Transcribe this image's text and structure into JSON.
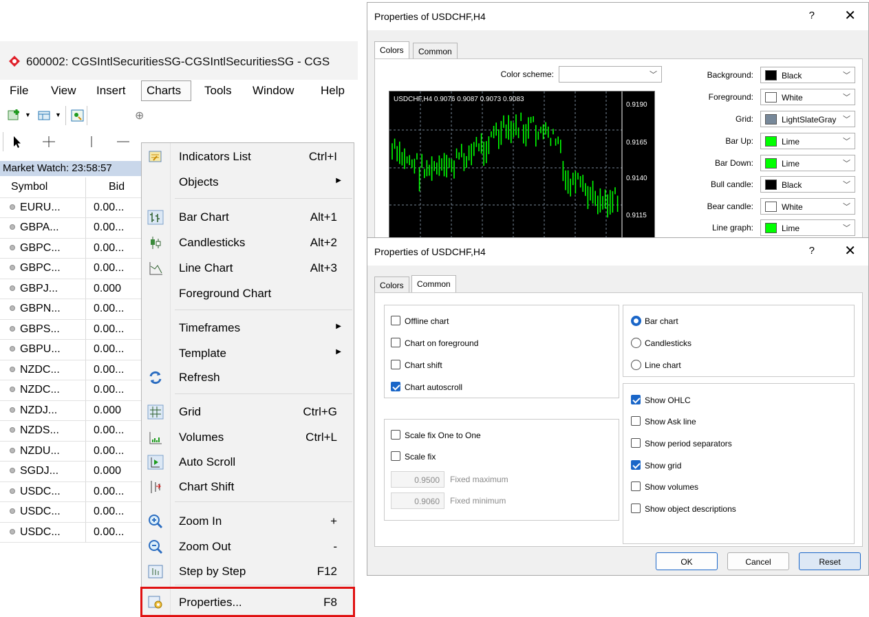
{
  "mt4": {
    "title": "600002: CGSIntlSecuritiesSG-CGSIntlSecuritiesSG - CGS",
    "menu": {
      "file": "File",
      "view": "View",
      "insert": "Insert",
      "charts": "Charts",
      "tools": "Tools",
      "window": "Window",
      "help": "Help"
    },
    "market_watch": {
      "header": "Market Watch: 23:58:57",
      "col_symbol": "Symbol",
      "col_bid": "Bid",
      "rows": [
        {
          "symbol": "EURU...",
          "bid": "0.00..."
        },
        {
          "symbol": "GBPA...",
          "bid": "0.00..."
        },
        {
          "symbol": "GBPC...",
          "bid": "0.00..."
        },
        {
          "symbol": "GBPC...",
          "bid": "0.00..."
        },
        {
          "symbol": "GBPJ...",
          "bid": "0.000"
        },
        {
          "symbol": "GBPN...",
          "bid": "0.00..."
        },
        {
          "symbol": "GBPS...",
          "bid": "0.00..."
        },
        {
          "symbol": "GBPU...",
          "bid": "0.00..."
        },
        {
          "symbol": "NZDC...",
          "bid": "0.00..."
        },
        {
          "symbol": "NZDC...",
          "bid": "0.00..."
        },
        {
          "symbol": "NZDJ...",
          "bid": "0.000"
        },
        {
          "symbol": "NZDS...",
          "bid": "0.00..."
        },
        {
          "symbol": "NZDU...",
          "bid": "0.00..."
        },
        {
          "symbol": "SGDJ...",
          "bid": "0.000"
        },
        {
          "symbol": "USDC...",
          "bid": "0.00..."
        },
        {
          "symbol": "USDC...",
          "bid": "0.00..."
        },
        {
          "symbol": "USDC...",
          "bid": "0.00..."
        }
      ]
    },
    "charts_menu": [
      {
        "label": "Indicators List",
        "shortcut": "Ctrl+I",
        "icon": "indicators-list-icon"
      },
      {
        "label": "Objects",
        "submenu": true
      },
      {
        "label": "Bar Chart",
        "shortcut": "Alt+1",
        "icon": "bar-chart-icon"
      },
      {
        "label": "Candlesticks",
        "shortcut": "Alt+2",
        "icon": "candlesticks-icon"
      },
      {
        "label": "Line Chart",
        "shortcut": "Alt+3",
        "icon": "line-chart-icon"
      },
      {
        "label": "Foreground Chart"
      },
      {
        "label": "Timeframes",
        "submenu": true
      },
      {
        "label": "Template",
        "submenu": true
      },
      {
        "label": "Refresh",
        "icon": "refresh-icon"
      },
      {
        "label": "Grid",
        "shortcut": "Ctrl+G",
        "icon": "grid-icon"
      },
      {
        "label": "Volumes",
        "shortcut": "Ctrl+L",
        "icon": "volumes-icon"
      },
      {
        "label": "Auto Scroll",
        "icon": "auto-scroll-icon"
      },
      {
        "label": "Chart Shift",
        "icon": "chart-shift-icon"
      },
      {
        "label": "Zoom In",
        "shortcut": "+",
        "icon": "zoom-in-icon"
      },
      {
        "label": "Zoom Out",
        "shortcut": "-",
        "icon": "zoom-out-icon"
      },
      {
        "label": "Step by Step",
        "shortcut": "F12",
        "icon": "step-by-step-icon"
      },
      {
        "label": "Properties...",
        "shortcut": "F8",
        "icon": "properties-icon"
      }
    ],
    "highlight_color": "#e01010"
  },
  "colors_dialog": {
    "title": "Properties of USDCHF,H4",
    "help": "?",
    "close": "✕",
    "tab_colors": "Colors",
    "tab_common": "Common",
    "color_scheme_label": "Color scheme:",
    "color_scheme_value": "",
    "preview_header": "USDCHF,H4  0.9076 0.9087 0.9073 0.9083",
    "preview_prices": [
      "0.9190",
      "0.9165",
      "0.9140",
      "0.9115"
    ],
    "rows": [
      {
        "label": "Background:",
        "value": "Black",
        "color": "#000000"
      },
      {
        "label": "Foreground:",
        "value": "White",
        "color": "#ffffff"
      },
      {
        "label": "Grid:",
        "value": "LightSlateGray",
        "color": "#778899"
      },
      {
        "label": "Bar Up:",
        "value": "Lime",
        "color": "#00ff00"
      },
      {
        "label": "Bar Down:",
        "value": "Lime",
        "color": "#00ff00"
      },
      {
        "label": "Bull candle:",
        "value": "Black",
        "color": "#000000"
      },
      {
        "label": "Bear candle:",
        "value": "White",
        "color": "#ffffff"
      },
      {
        "label": "Line graph:",
        "value": "Lime",
        "color": "#00ff00"
      }
    ]
  },
  "common_dialog": {
    "title": "Properties of USDCHF,H4",
    "help": "?",
    "close": "✕",
    "tab_colors": "Colors",
    "tab_common": "Common",
    "group1": [
      {
        "label": "Offline chart",
        "checked": false
      },
      {
        "label": "Chart on foreground",
        "checked": false
      },
      {
        "label": "Chart shift",
        "checked": false
      },
      {
        "label": "Chart autoscroll",
        "checked": true
      }
    ],
    "group2": [
      {
        "label": "Scale fix One to One",
        "checked": false
      },
      {
        "label": "Scale fix",
        "checked": false
      }
    ],
    "fixed_max_value": "0.9500",
    "fixed_max_label": "Fixed maximum",
    "fixed_min_value": "0.9060",
    "fixed_min_label": "Fixed minimum",
    "chart_type": [
      {
        "label": "Bar chart",
        "selected": true
      },
      {
        "label": "Candlesticks",
        "selected": false
      },
      {
        "label": "Line chart",
        "selected": false
      }
    ],
    "show": [
      {
        "label": "Show OHLC",
        "checked": true
      },
      {
        "label": "Show Ask line",
        "checked": false
      },
      {
        "label": "Show period separators",
        "checked": false
      },
      {
        "label": "Show grid",
        "checked": true
      },
      {
        "label": "Show volumes",
        "checked": false
      },
      {
        "label": "Show object descriptions",
        "checked": false
      }
    ],
    "ok": "OK",
    "cancel": "Cancel",
    "reset": "Reset"
  }
}
